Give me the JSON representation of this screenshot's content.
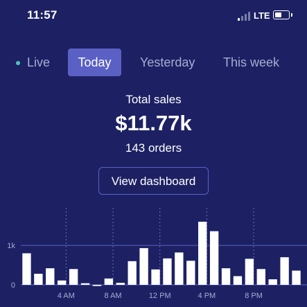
{
  "status_bar": {
    "time": "11:57",
    "network": "LTE",
    "signal_bars_filled": 1,
    "signal_bars_total": 4,
    "battery_level": 0.45
  },
  "tabs": [
    {
      "label": "Live",
      "active": false
    },
    {
      "label": "Today",
      "active": true
    },
    {
      "label": "Yesterday",
      "active": false
    },
    {
      "label": "This week",
      "active": false
    }
  ],
  "summary": {
    "label": "Total sales",
    "value": "$11.77k",
    "orders": "143 orders"
  },
  "button": {
    "label": "View dashboard"
  },
  "colors": {
    "background": "#1d2163",
    "accent": "#5a60c4",
    "live_dot": "#4fc3b8",
    "bar": "#ffffff",
    "gridline": "#5a62c8"
  },
  "chart_data": {
    "type": "bar",
    "x": [
      "12 AM",
      "1 AM",
      "2 AM",
      "3 AM",
      "4 AM",
      "5 AM",
      "6 AM",
      "7 AM",
      "8 AM",
      "9 AM",
      "10 AM",
      "11 AM",
      "12 PM",
      "1 PM",
      "2 PM",
      "3 PM",
      "4 PM",
      "5 PM",
      "6 PM",
      "7 PM",
      "8 PM",
      "9 PM",
      "10 PM",
      "11 PM",
      "12 AM"
    ],
    "values": [
      800,
      280,
      420,
      110,
      400,
      40,
      -30,
      160,
      50,
      600,
      930,
      390,
      670,
      820,
      610,
      1600,
      1360,
      420,
      220,
      660,
      400,
      140,
      700,
      360
    ],
    "xtick_labels": [
      "4 AM",
      "8 AM",
      "12 PM",
      "4 PM",
      "8 PM"
    ],
    "xtick_indices": [
      4,
      8,
      12,
      16,
      20
    ],
    "ytick_labels": [
      "1k",
      "0"
    ],
    "ytick_values": [
      1000,
      0
    ],
    "ylim": [
      0,
      1700
    ],
    "grid": true
  }
}
